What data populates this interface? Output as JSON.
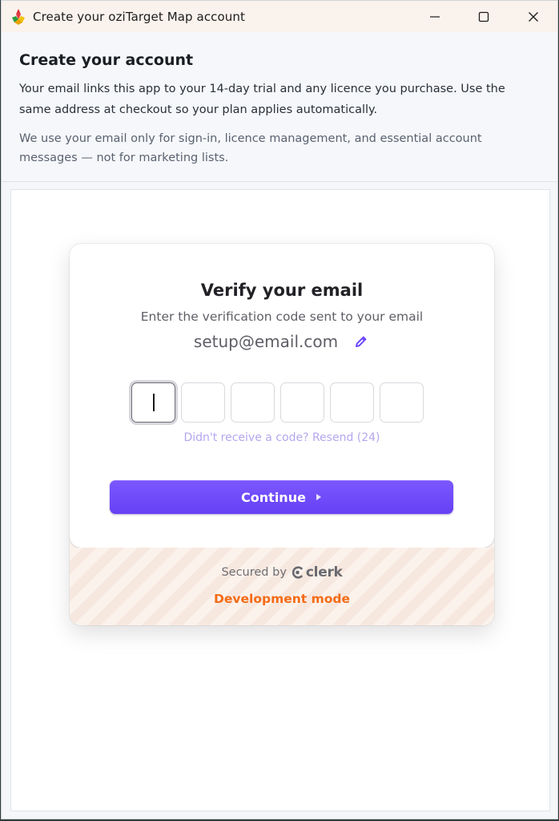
{
  "window": {
    "title": "Create your oziTarget Map account",
    "icons": {
      "app": "app-logo-icon",
      "minimize": "minimize-icon",
      "maximize": "maximize-icon",
      "close": "close-icon"
    }
  },
  "header": {
    "title": "Create your account",
    "description": "Your email links this app to your 14-day trial and any licence you purchase. Use the same address at checkout so your plan applies automatically.",
    "note": "We use your email only for sign-in, licence management, and essential account messages — not for marketing lists."
  },
  "verify": {
    "title": "Verify your email",
    "subtitle": "Enter the verification code sent to your email",
    "email": "setup@email.com",
    "code_digits": [
      "",
      "",
      "",
      "",
      "",
      ""
    ],
    "resend_label": "Didn't receive a code? Resend (24)",
    "continue_label": "Continue"
  },
  "footer": {
    "secured_by": "Secured by",
    "brand": "clerk",
    "dev_mode": "Development mode"
  },
  "colors": {
    "accent": "#6c47ff",
    "dev_mode": "#f36b16",
    "resend": "#b5a6ef"
  }
}
